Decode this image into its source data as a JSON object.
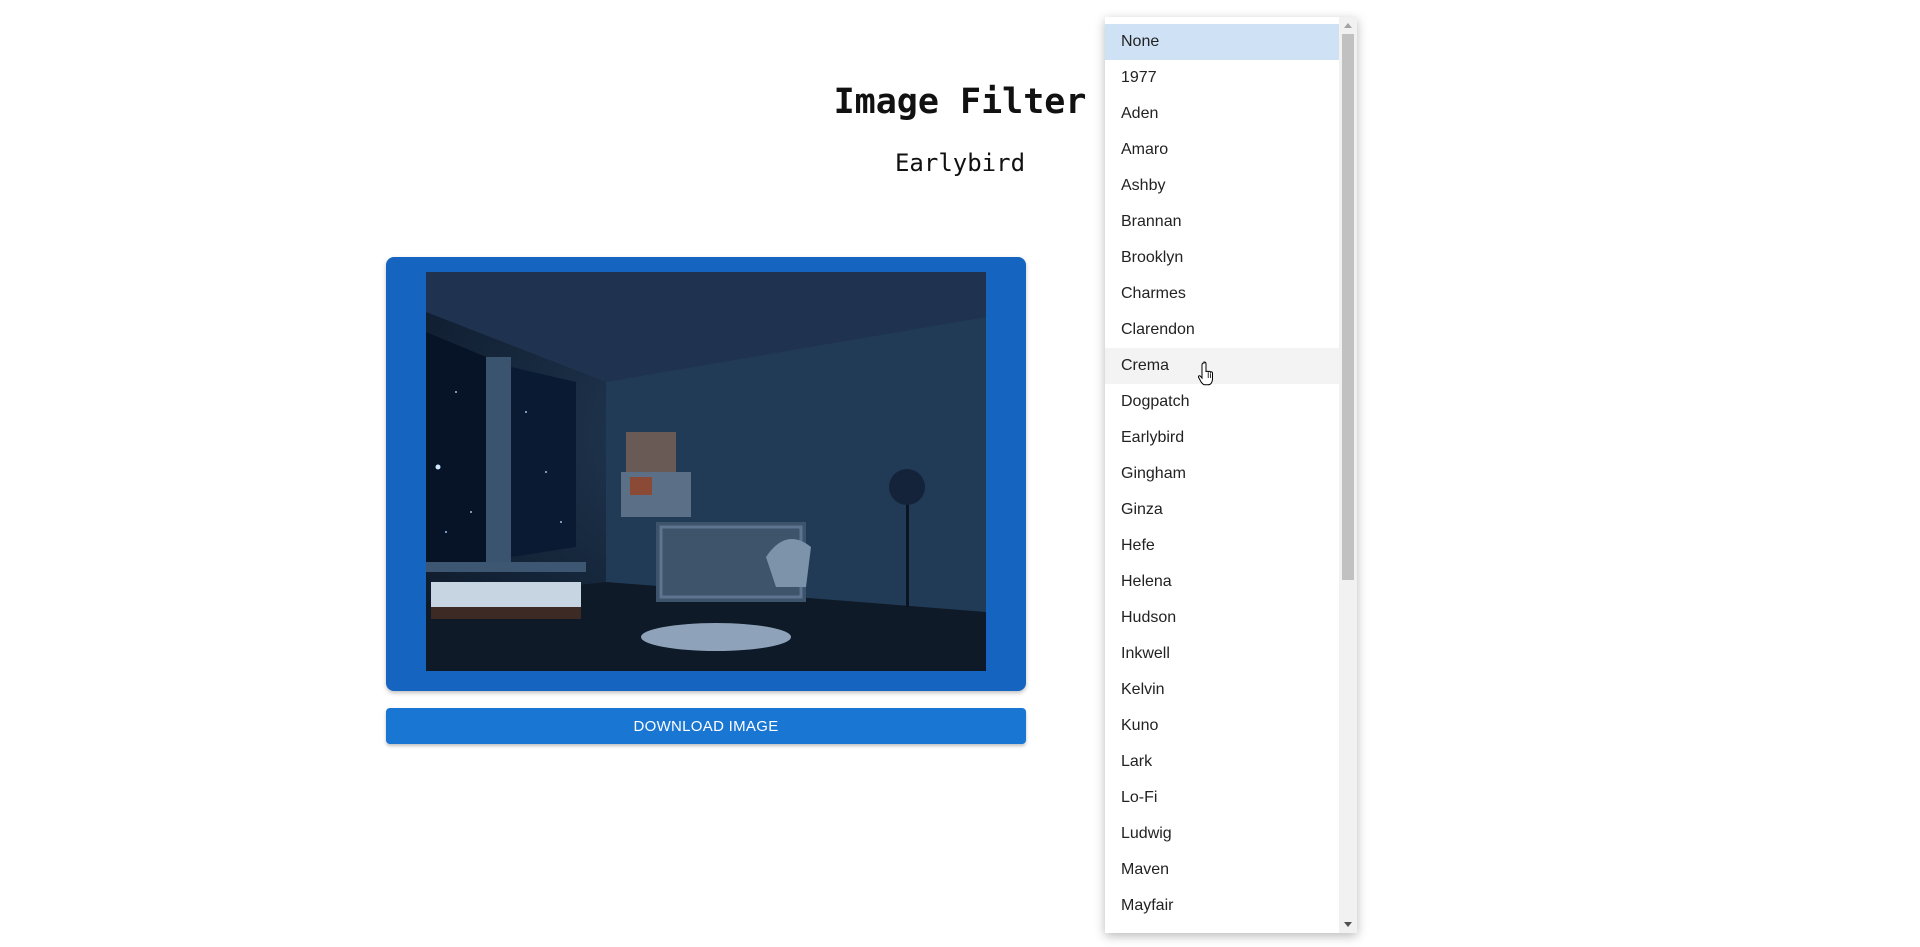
{
  "page": {
    "title": "Image Filter",
    "current_filter": "Earlybird"
  },
  "image_panel": {
    "background_color": "#1565c0",
    "image_description_icon": "night-nursery-photo"
  },
  "download": {
    "label": "DOWNLOAD IMAGE",
    "color": "#1976d2"
  },
  "filter_dropdown": {
    "selected": "None",
    "hovered": "Crema",
    "options": [
      "None",
      "1977",
      "Aden",
      "Amaro",
      "Ashby",
      "Brannan",
      "Brooklyn",
      "Charmes",
      "Clarendon",
      "Crema",
      "Dogpatch",
      "Earlybird",
      "Gingham",
      "Ginza",
      "Hefe",
      "Helena",
      "Hudson",
      "Inkwell",
      "Kelvin",
      "Kuno",
      "Lark",
      "Lo-Fi",
      "Ludwig",
      "Maven",
      "Mayfair"
    ],
    "selected_color": "#cfe2f5"
  }
}
